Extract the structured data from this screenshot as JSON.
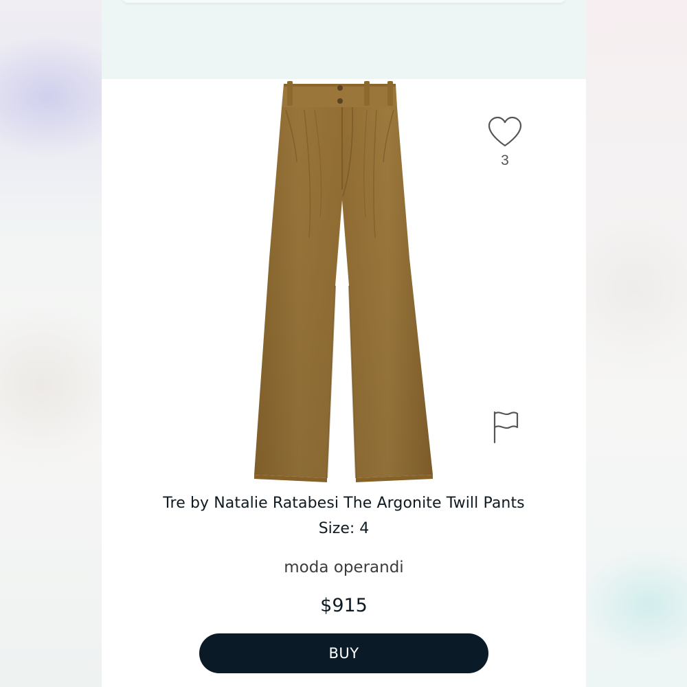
{
  "product": {
    "title": "Tre by Natalie Ratabesi The Argonite Twill Pants",
    "size": "Size: 4",
    "brand": "moda operandi",
    "price": "$915",
    "image_color": "#9a7437"
  },
  "actions": {
    "like_icon": "heart-outline-icon",
    "like_count": "3",
    "flag_icon": "flag-outline-icon",
    "buy_label": "BUY",
    "buy_color": "#0b1a27"
  },
  "theme": {
    "top_band_color": "#eef6f5",
    "screen_background": "#ffffff",
    "text_color": "#0e1a22"
  }
}
